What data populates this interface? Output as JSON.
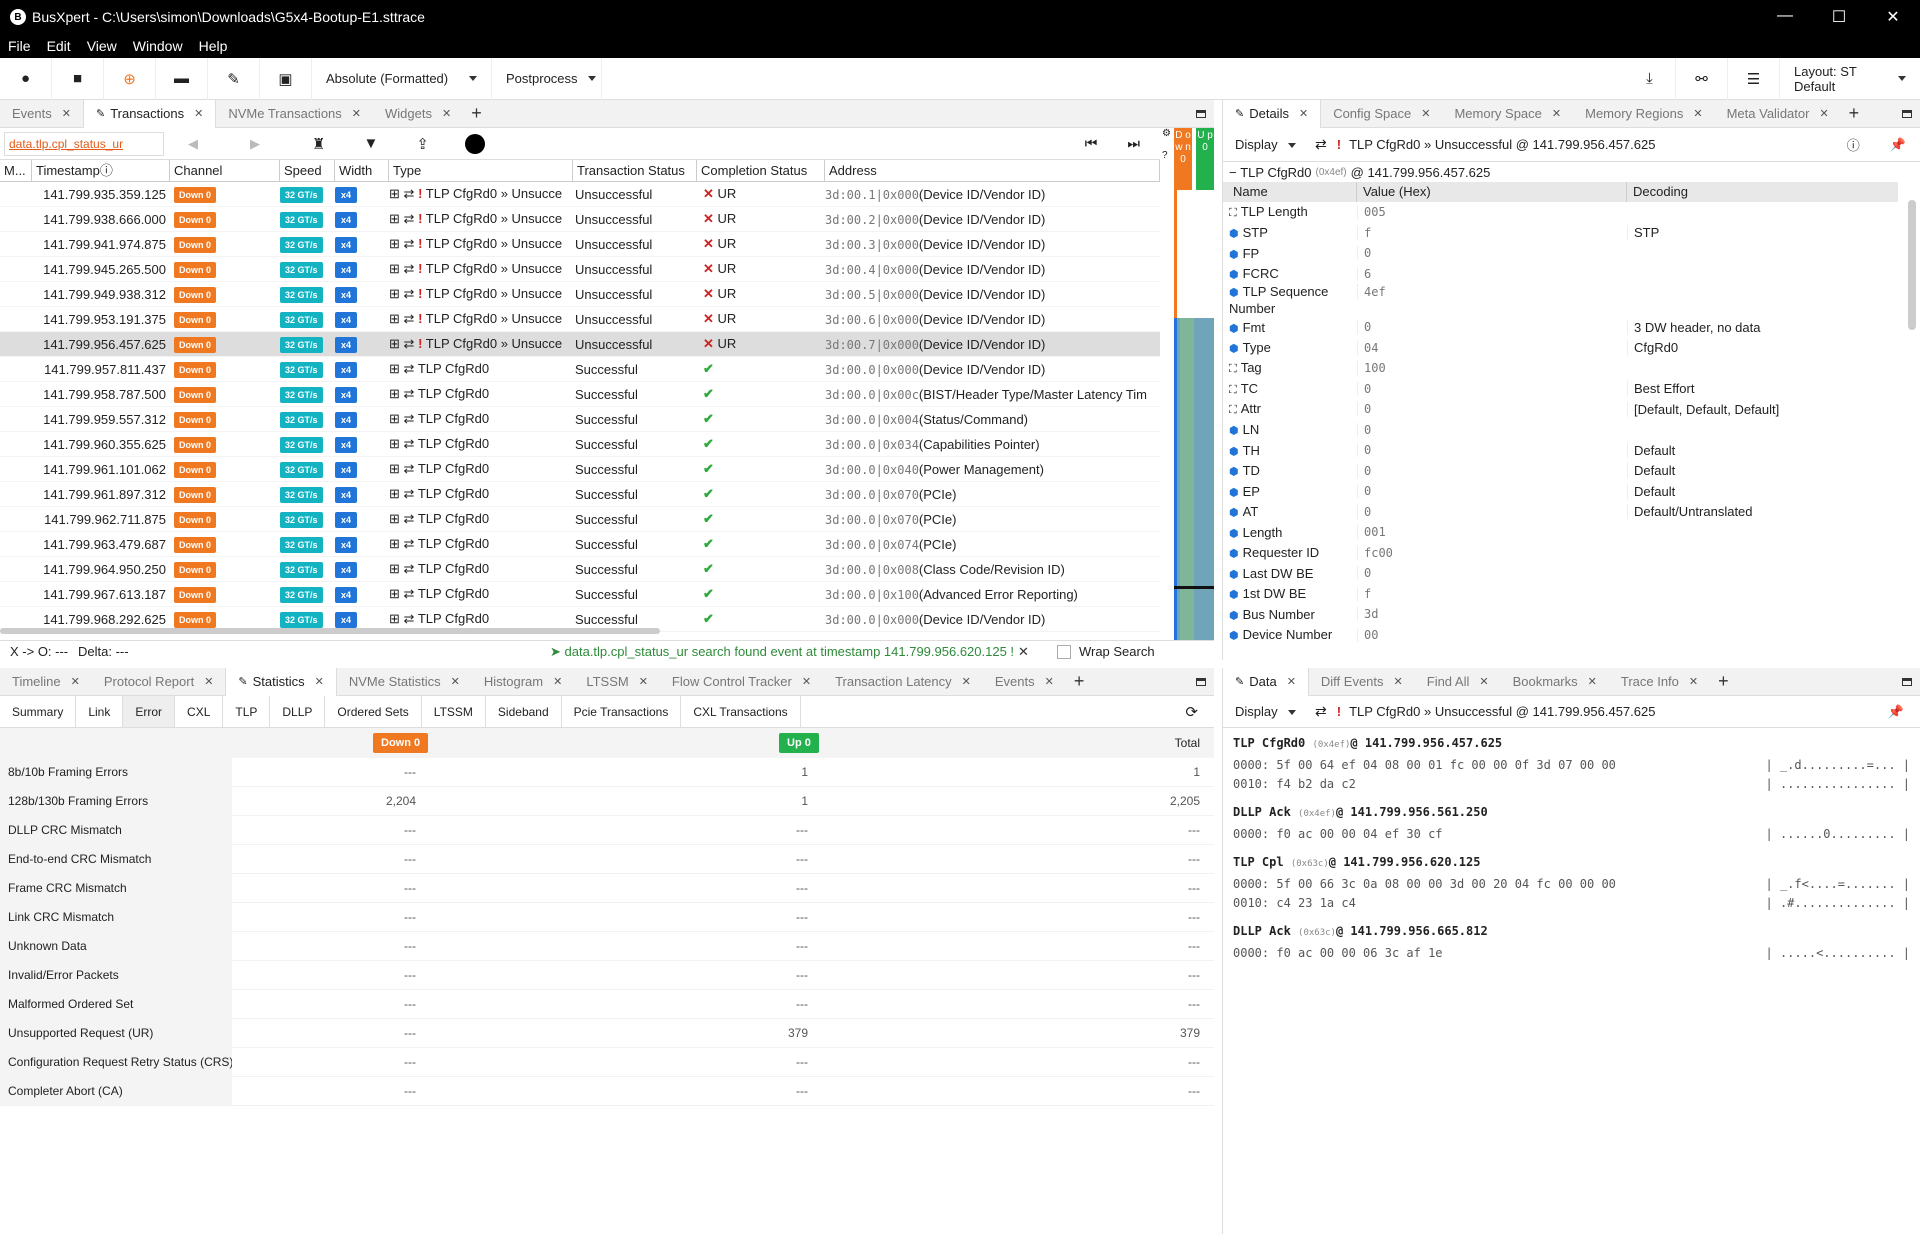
{
  "window": {
    "title": "BusXpert - C:\\Users\\simon\\Downloads\\G5x4-Bootup-E1.sttrace",
    "logo": "B"
  },
  "menu": [
    "File",
    "Edit",
    "View",
    "Window",
    "Help"
  ],
  "toolbar": {
    "timestamp_mode": "Absolute (Formatted)",
    "postprocess": "Postprocess",
    "layout": "Layout: ST Default"
  },
  "top_left_tabs": [
    {
      "label": "Events",
      "active": false
    },
    {
      "label": "Transactions",
      "active": true
    },
    {
      "label": "NVMe Transactions",
      "active": false
    },
    {
      "label": "Widgets",
      "active": false
    }
  ],
  "search": {
    "value": "data.tlp.cpl_status_ur"
  },
  "transactions": {
    "columns": [
      "M...",
      "Timestamp",
      "Channel",
      "Speed",
      "Width",
      "Type",
      "Transaction Status",
      "Completion Status",
      "Address"
    ],
    "rows": [
      {
        "ts": "141.799.935.359.125",
        "ch": "Down 0",
        "speed": "32 GT/s",
        "width": "x4",
        "type": "TLP CfgRd0 » Unsucce",
        "err": true,
        "status": "Unsuccessful",
        "cpl": "UR",
        "ok": false,
        "addr": "3d:00.1|0x000",
        "reg": "(Device ID/Vendor ID)",
        "sel": false
      },
      {
        "ts": "141.799.938.666.000",
        "ch": "Down 0",
        "speed": "32 GT/s",
        "width": "x4",
        "type": "TLP CfgRd0 » Unsucce",
        "err": true,
        "status": "Unsuccessful",
        "cpl": "UR",
        "ok": false,
        "addr": "3d:00.2|0x000",
        "reg": "(Device ID/Vendor ID)",
        "sel": false
      },
      {
        "ts": "141.799.941.974.875",
        "ch": "Down 0",
        "speed": "32 GT/s",
        "width": "x4",
        "type": "TLP CfgRd0 » Unsucce",
        "err": true,
        "status": "Unsuccessful",
        "cpl": "UR",
        "ok": false,
        "addr": "3d:00.3|0x000",
        "reg": "(Device ID/Vendor ID)",
        "sel": false
      },
      {
        "ts": "141.799.945.265.500",
        "ch": "Down 0",
        "speed": "32 GT/s",
        "width": "x4",
        "type": "TLP CfgRd0 » Unsucce",
        "err": true,
        "status": "Unsuccessful",
        "cpl": "UR",
        "ok": false,
        "addr": "3d:00.4|0x000",
        "reg": "(Device ID/Vendor ID)",
        "sel": false
      },
      {
        "ts": "141.799.949.938.312",
        "ch": "Down 0",
        "speed": "32 GT/s",
        "width": "x4",
        "type": "TLP CfgRd0 » Unsucce",
        "err": true,
        "status": "Unsuccessful",
        "cpl": "UR",
        "ok": false,
        "addr": "3d:00.5|0x000",
        "reg": "(Device ID/Vendor ID)",
        "sel": false
      },
      {
        "ts": "141.799.953.191.375",
        "ch": "Down 0",
        "speed": "32 GT/s",
        "width": "x4",
        "type": "TLP CfgRd0 » Unsucce",
        "err": true,
        "status": "Unsuccessful",
        "cpl": "UR",
        "ok": false,
        "addr": "3d:00.6|0x000",
        "reg": "(Device ID/Vendor ID)",
        "sel": false
      },
      {
        "ts": "141.799.956.457.625",
        "ch": "Down 0",
        "speed": "32 GT/s",
        "width": "x4",
        "type": "TLP CfgRd0 » Unsucce",
        "err": true,
        "status": "Unsuccessful",
        "cpl": "UR",
        "ok": false,
        "addr": "3d:00.7|0x000",
        "reg": "(Device ID/Vendor ID)",
        "sel": true
      },
      {
        "ts": "141.799.957.811.437",
        "ch": "Down 0",
        "speed": "32 GT/s",
        "width": "x4",
        "type": "TLP CfgRd0",
        "err": false,
        "status": "Successful",
        "cpl": "",
        "ok": true,
        "addr": "3d:00.0|0x000",
        "reg": "(Device ID/Vendor ID)",
        "sel": false
      },
      {
        "ts": "141.799.958.787.500",
        "ch": "Down 0",
        "speed": "32 GT/s",
        "width": "x4",
        "type": "TLP CfgRd0",
        "err": false,
        "status": "Successful",
        "cpl": "",
        "ok": true,
        "addr": "3d:00.0|0x00c",
        "reg": "(BIST/Header Type/Master Latency Tim",
        "sel": false
      },
      {
        "ts": "141.799.959.557.312",
        "ch": "Down 0",
        "speed": "32 GT/s",
        "width": "x4",
        "type": "TLP CfgRd0",
        "err": false,
        "status": "Successful",
        "cpl": "",
        "ok": true,
        "addr": "3d:00.0|0x004",
        "reg": "(Status/Command)",
        "sel": false
      },
      {
        "ts": "141.799.960.355.625",
        "ch": "Down 0",
        "speed": "32 GT/s",
        "width": "x4",
        "type": "TLP CfgRd0",
        "err": false,
        "status": "Successful",
        "cpl": "",
        "ok": true,
        "addr": "3d:00.0|0x034",
        "reg": "(Capabilities Pointer)",
        "sel": false
      },
      {
        "ts": "141.799.961.101.062",
        "ch": "Down 0",
        "speed": "32 GT/s",
        "width": "x4",
        "type": "TLP CfgRd0",
        "err": false,
        "status": "Successful",
        "cpl": "",
        "ok": true,
        "addr": "3d:00.0|0x040",
        "reg": "(Power Management)",
        "sel": false
      },
      {
        "ts": "141.799.961.897.312",
        "ch": "Down 0",
        "speed": "32 GT/s",
        "width": "x4",
        "type": "TLP CfgRd0",
        "err": false,
        "status": "Successful",
        "cpl": "",
        "ok": true,
        "addr": "3d:00.0|0x070",
        "reg": "(PCIe)",
        "sel": false
      },
      {
        "ts": "141.799.962.711.875",
        "ch": "Down 0",
        "speed": "32 GT/s",
        "width": "x4",
        "type": "TLP CfgRd0",
        "err": false,
        "status": "Successful",
        "cpl": "",
        "ok": true,
        "addr": "3d:00.0|0x070",
        "reg": "(PCIe)",
        "sel": false
      },
      {
        "ts": "141.799.963.479.687",
        "ch": "Down 0",
        "speed": "32 GT/s",
        "width": "x4",
        "type": "TLP CfgRd0",
        "err": false,
        "status": "Successful",
        "cpl": "",
        "ok": true,
        "addr": "3d:00.0|0x074",
        "reg": "(PCIe)",
        "sel": false
      },
      {
        "ts": "141.799.964.950.250",
        "ch": "Down 0",
        "speed": "32 GT/s",
        "width": "x4",
        "type": "TLP CfgRd0",
        "err": false,
        "status": "Successful",
        "cpl": "",
        "ok": true,
        "addr": "3d:00.0|0x008",
        "reg": "(Class Code/Revision ID)",
        "sel": false
      },
      {
        "ts": "141.799.967.613.187",
        "ch": "Down 0",
        "speed": "32 GT/s",
        "width": "x4",
        "type": "TLP CfgRd0",
        "err": false,
        "status": "Successful",
        "cpl": "",
        "ok": true,
        "addr": "3d:00.0|0x100",
        "reg": "(Advanced Error Reporting)",
        "sel": false
      },
      {
        "ts": "141.799.968.292.625",
        "ch": "Down 0",
        "speed": "32 GT/s",
        "width": "x4",
        "type": "TLP CfgRd0",
        "err": false,
        "status": "Successful",
        "cpl": "",
        "ok": true,
        "addr": "3d:00.0|0x000",
        "reg": "(Device ID/Vendor ID)",
        "sel": false
      }
    ]
  },
  "status_bar": {
    "xo": "X -> O: ---",
    "delta": "Delta: ---",
    "message": "data.tlp.cpl_status_ur search found event at timestamp 141.799.956.620.125 !",
    "wrap": "Wrap Search"
  },
  "lanes": {
    "down": "D o w n 0",
    "up": "U p 0"
  },
  "details": {
    "tabs": [
      "Details",
      "Config Space",
      "Memory Space",
      "Memory Regions",
      "Meta Validator"
    ],
    "display": "Display",
    "crumb": "TLP CfgRd0 » Unsuccessful @ 141.799.956.457.625",
    "heading": "TLP CfgRd0",
    "heading_id": "(0x4ef)",
    "heading_ts": "@ 141.799.956.457.625",
    "cols": [
      "Name",
      "Value (Hex)",
      "Decoding"
    ],
    "fields": [
      {
        "name": "TLP Length",
        "value": "005",
        "dec": ""
      },
      {
        "name": "STP",
        "value": "f",
        "dec": "STP"
      },
      {
        "name": "FP",
        "value": "0",
        "dec": ""
      },
      {
        "name": "FCRC",
        "value": "6",
        "dec": ""
      },
      {
        "name": "TLP Sequence Number",
        "value": "4ef",
        "dec": ""
      },
      {
        "name": "Fmt",
        "value": "0",
        "dec": "3 DW header, no data"
      },
      {
        "name": "Type",
        "value": "04",
        "dec": "CfgRd0"
      },
      {
        "name": "Tag",
        "value": "100",
        "dec": ""
      },
      {
        "name": "TC",
        "value": "0",
        "dec": "Best Effort"
      },
      {
        "name": "Attr",
        "value": "0",
        "dec": "[Default, Default, Default]"
      },
      {
        "name": "LN",
        "value": "0",
        "dec": ""
      },
      {
        "name": "TH",
        "value": "0",
        "dec": "Default"
      },
      {
        "name": "TD",
        "value": "0",
        "dec": "Default"
      },
      {
        "name": "EP",
        "value": "0",
        "dec": "Default"
      },
      {
        "name": "AT",
        "value": "0",
        "dec": "Default/Untranslated"
      },
      {
        "name": "Length",
        "value": "001",
        "dec": ""
      },
      {
        "name": "Requester ID",
        "value": "fc00",
        "dec": ""
      },
      {
        "name": "Last DW BE",
        "value": "0",
        "dec": ""
      },
      {
        "name": "1st DW BE",
        "value": "f",
        "dec": ""
      },
      {
        "name": "Bus Number",
        "value": "3d",
        "dec": ""
      },
      {
        "name": "Device Number",
        "value": "00",
        "dec": ""
      }
    ]
  },
  "bottom_left_tabs": [
    "Timeline",
    "Protocol Report",
    "Statistics",
    "NVMe Statistics",
    "Histogram",
    "LTSSM",
    "Flow Control Tracker",
    "Transaction Latency",
    "Events"
  ],
  "stat_subtabs": [
    "Summary",
    "Link",
    "Error",
    "CXL",
    "TLP",
    "DLLP",
    "Ordered Sets",
    "LTSSM",
    "Sideband",
    "Pcie Transactions",
    "CXL Transactions"
  ],
  "stats": {
    "col_down": "Down 0",
    "col_up": "Up 0",
    "col_total": "Total",
    "rows": [
      {
        "name": "8b/10b Framing Errors",
        "down": "---",
        "up": "1",
        "total": "1"
      },
      {
        "name": "128b/130b Framing Errors",
        "down": "2,204",
        "up": "1",
        "total": "2,205"
      },
      {
        "name": "DLLP CRC Mismatch",
        "down": "---",
        "up": "---",
        "total": "---"
      },
      {
        "name": "End-to-end CRC Mismatch",
        "down": "---",
        "up": "---",
        "total": "---"
      },
      {
        "name": "Frame CRC Mismatch",
        "down": "---",
        "up": "---",
        "total": "---"
      },
      {
        "name": "Link CRC Mismatch",
        "down": "---",
        "up": "---",
        "total": "---"
      },
      {
        "name": "Unknown Data",
        "down": "---",
        "up": "---",
        "total": "---"
      },
      {
        "name": "Invalid/Error Packets",
        "down": "---",
        "up": "---",
        "total": "---"
      },
      {
        "name": "Malformed Ordered Set",
        "down": "---",
        "up": "---",
        "total": "---"
      },
      {
        "name": "Unsupported Request (UR)",
        "down": "---",
        "up": "379",
        "total": "379"
      },
      {
        "name": "Configuration Request Retry Status (CRS)",
        "down": "---",
        "up": "---",
        "total": "---"
      },
      {
        "name": "Completer Abort (CA)",
        "down": "---",
        "up": "---",
        "total": "---"
      }
    ]
  },
  "data_panel": {
    "tabs": [
      "Data",
      "Diff Events",
      "Find All",
      "Bookmarks",
      "Trace Info"
    ],
    "display": "Display",
    "crumb": "TLP CfgRd0 » Unsuccessful @ 141.799.956.457.625",
    "packets": [
      {
        "name": "TLP CfgRd0",
        "id": "(0x4ef)",
        "ts": "@ 141.799.956.457.625",
        "lines": [
          {
            "hex": "0000: 5f 00 64 ef 04 08 00 01 fc 00 00 0f 3d 07 00 00",
            "ascii": "| _.d.........=... |"
          },
          {
            "hex": "0010: f4 b2 da c2",
            "ascii": "| ................ |"
          }
        ]
      },
      {
        "name": "DLLP Ack",
        "id": "(0x4ef)",
        "ts": "@ 141.799.956.561.250",
        "lines": [
          {
            "hex": "0000: f0 ac 00 00 04 ef 30 cf",
            "ascii": "| ......0......... |"
          }
        ]
      },
      {
        "name": "TLP Cpl",
        "id": "(0x63c)",
        "ts": "@ 141.799.956.620.125",
        "lines": [
          {
            "hex": "0000: 5f 00 66 3c 0a 08 00 00 3d 00 20 04 fc 00 00 00",
            "ascii": "| _.f<....=....... |"
          },
          {
            "hex": "0010: c4 23 1a c4",
            "ascii": "| .#.............. |"
          }
        ]
      },
      {
        "name": "DLLP Ack",
        "id": "(0x63c)",
        "ts": "@ 141.799.956.665.812",
        "lines": [
          {
            "hex": "0000: f0 ac 00 00 06 3c af 1e",
            "ascii": "| .....<.......... |"
          }
        ]
      }
    ]
  },
  "colors": {
    "down": "#f07820",
    "up": "#22b14c",
    "speed": "#14b3c2",
    "width": "#2275d8",
    "search": "#e45a18",
    "ok": "#2eaa3c",
    "err": "#cc2222"
  }
}
